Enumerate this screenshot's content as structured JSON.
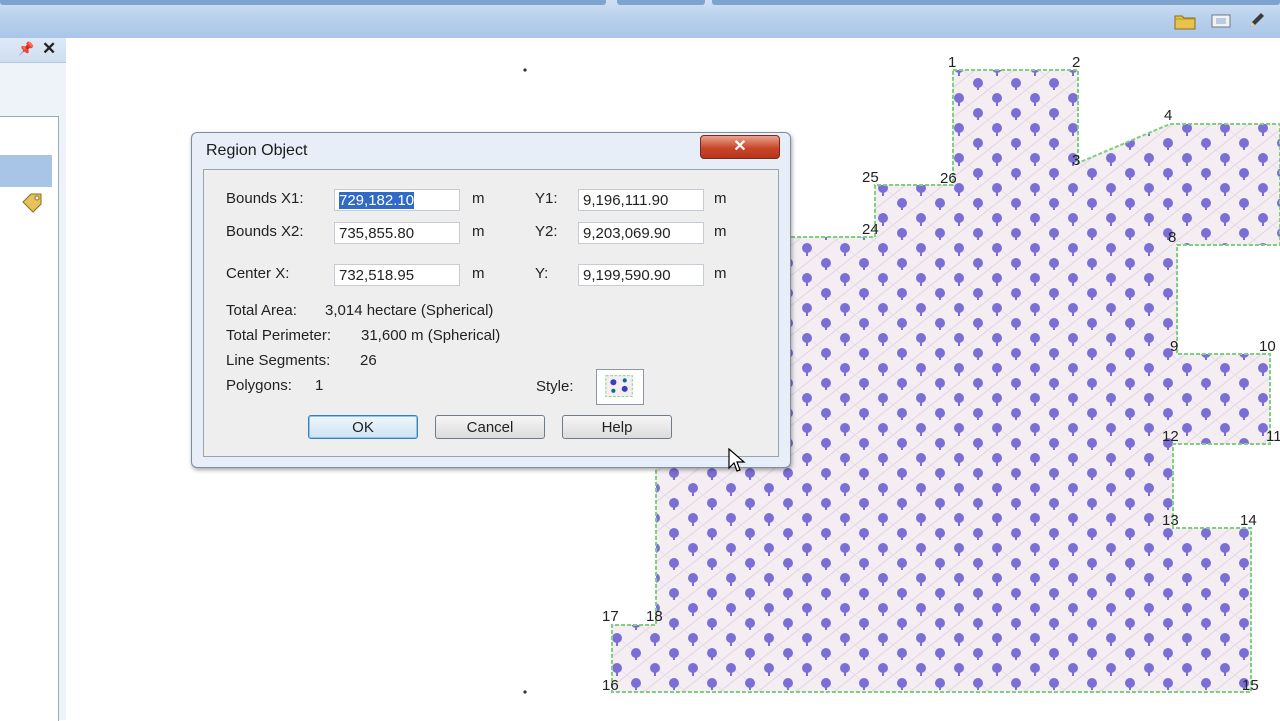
{
  "dialog": {
    "title": "Region Object",
    "close_label": "✕",
    "bounds_x1_label": "Bounds X1:",
    "bounds_x1_value": "729,182.10",
    "bounds_x2_label": "Bounds X2:",
    "bounds_x2_value": "735,855.80",
    "center_x_label": "Center X:",
    "center_x_value": "732,518.95",
    "y1_label": "Y1:",
    "y1_value": "9,196,111.90",
    "y2_label": "Y2:",
    "y2_value": "9,203,069.90",
    "y_label": "Y:",
    "y_value": "9,199,590.90",
    "unit": "m",
    "total_area_label": "Total Area:",
    "total_area_value": "3,014 hectare (Spherical)",
    "total_perimeter_label": "Total Perimeter:",
    "total_perimeter_value": "31,600 m (Spherical)",
    "line_segments_label": "Line Segments:",
    "line_segments_value": "26",
    "polygons_label": "Polygons:",
    "polygons_value": "1",
    "style_label": "Style:",
    "ok_label": "OK",
    "cancel_label": "Cancel",
    "help_label": "Help"
  },
  "map": {
    "vertex_labels": [
      "1",
      "2",
      "3",
      "4",
      "8",
      "9",
      "10",
      "11",
      "12",
      "13",
      "14",
      "15",
      "16",
      "17",
      "18",
      "24",
      "25",
      "26"
    ]
  },
  "colors": {
    "region_fill": "#f4eef2",
    "region_pattern": "#7b6fd6",
    "region_outline": "#7dd07d",
    "selection": "#3169c6"
  },
  "icons": [
    "pin-icon",
    "close-icon",
    "folder-icon",
    "layer-icon",
    "pencil-icon",
    "tag-icon",
    "style-swatch-icon",
    "mouse-cursor-icon"
  ]
}
